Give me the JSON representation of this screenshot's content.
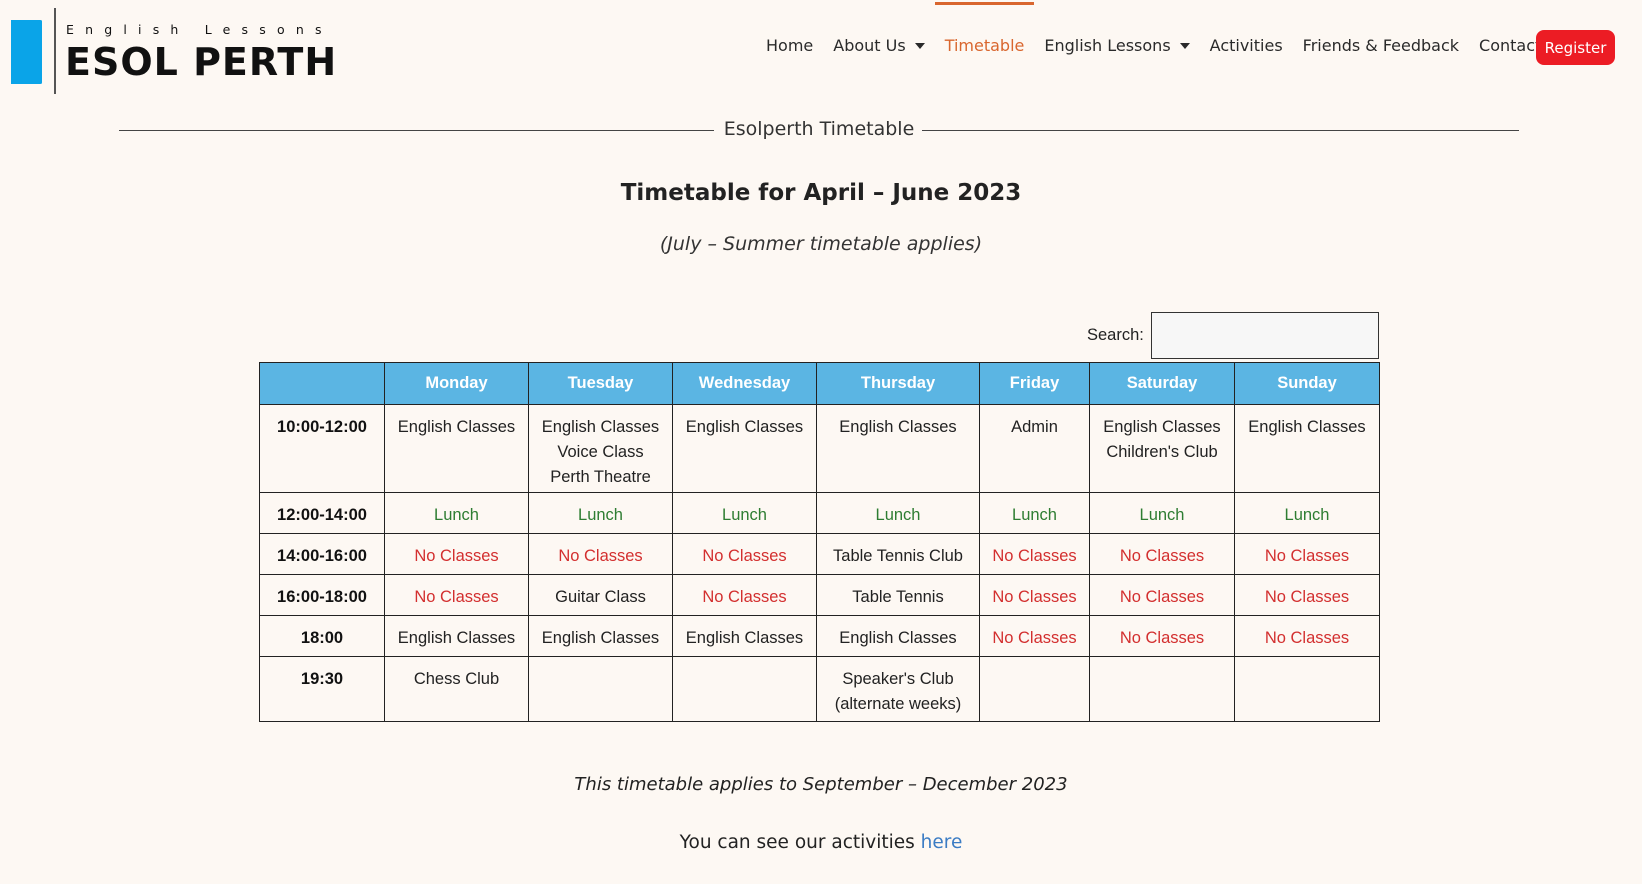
{
  "logo": {
    "tagline": "English Lessons",
    "brand": "ESOL PERTH"
  },
  "nav": {
    "items": [
      {
        "label": "Home",
        "dropdown": false,
        "active": false
      },
      {
        "label": "About Us",
        "dropdown": true,
        "active": false
      },
      {
        "label": "Timetable",
        "dropdown": false,
        "active": true
      },
      {
        "label": "English Lessons",
        "dropdown": true,
        "active": false
      },
      {
        "label": "Activities",
        "dropdown": false,
        "active": false
      },
      {
        "label": "Friends & Feedback",
        "dropdown": false,
        "active": false
      },
      {
        "label": "Contact",
        "dropdown": false,
        "active": false
      }
    ],
    "register_label": "Register"
  },
  "page": {
    "section_heading": "Esolperth Timetable",
    "title": "Timetable for April – June 2023",
    "subtitle": "(July – Summer timetable applies)",
    "footnote": "This timetable applies to September – December 2023",
    "activities_prefix": "You can see our activities ",
    "activities_link": "here"
  },
  "search": {
    "label": "Search:",
    "value": "",
    "placeholder": ""
  },
  "timetable": {
    "days": [
      "Monday",
      "Tuesday",
      "Wednesday",
      "Thursday",
      "Friday",
      "Saturday",
      "Sunday"
    ],
    "rows": [
      {
        "time": "10:00-12:00",
        "cells": [
          [
            "English Classes"
          ],
          [
            "English Classes",
            "Voice Class",
            "Perth Theatre"
          ],
          [
            "English Classes"
          ],
          [
            "English Classes"
          ],
          [
            "Admin"
          ],
          [
            "English Classes",
            "Children's Club"
          ],
          [
            "English Classes"
          ]
        ]
      },
      {
        "time": "12:00-14:00",
        "cells": [
          [
            "Lunch"
          ],
          [
            "Lunch"
          ],
          [
            "Lunch"
          ],
          [
            "Lunch"
          ],
          [
            "Lunch"
          ],
          [
            "Lunch"
          ],
          [
            "Lunch"
          ]
        ]
      },
      {
        "time": "14:00-16:00",
        "cells": [
          [
            "No Classes"
          ],
          [
            "No Classes"
          ],
          [
            "No Classes"
          ],
          [
            "Table Tennis Club"
          ],
          [
            "No Classes"
          ],
          [
            "No Classes"
          ],
          [
            "No Classes"
          ]
        ]
      },
      {
        "time": "16:00-18:00",
        "cells": [
          [
            "No Classes"
          ],
          [
            "Guitar Class"
          ],
          [
            "No Classes"
          ],
          [
            "Table Tennis"
          ],
          [
            "No Classes"
          ],
          [
            "No Classes"
          ],
          [
            "No Classes"
          ]
        ]
      },
      {
        "time": "18:00",
        "cells": [
          [
            "English Classes"
          ],
          [
            "English Classes"
          ],
          [
            "English Classes"
          ],
          [
            "English Classes"
          ],
          [
            "No Classes"
          ],
          [
            "No Classes"
          ],
          [
            "No Classes"
          ]
        ]
      },
      {
        "time": "19:30",
        "cells": [
          [
            "Chess Club"
          ],
          [],
          [],
          [
            "Speaker's Club",
            "(alternate weeks)"
          ],
          [],
          [],
          []
        ]
      }
    ]
  },
  "colors": {
    "accent": "#d9662e",
    "register": "#ec1c24",
    "header_row": "#5bb5e3",
    "lunch": "#2e7d32",
    "no_classes": "#d32f2f",
    "link": "#3b7cc4",
    "logo_bar": "#0aa4e8"
  }
}
